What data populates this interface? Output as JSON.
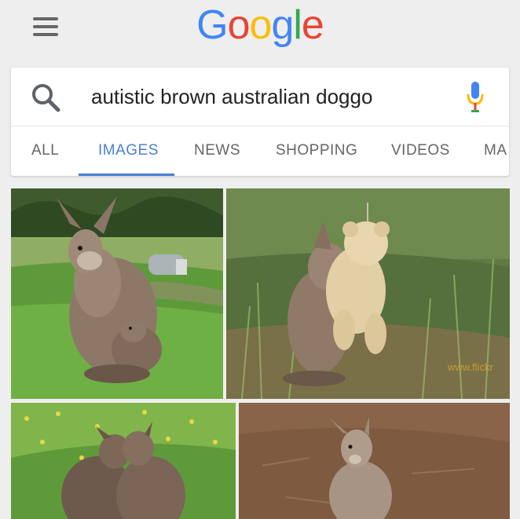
{
  "logo": {
    "letters": [
      "G",
      "o",
      "o",
      "g",
      "l",
      "e"
    ],
    "colors": [
      "#4285F4",
      "#EA4335",
      "#FBBC05",
      "#4285F4",
      "#34A853",
      "#EA4335"
    ]
  },
  "search": {
    "query": "autistic brown australian doggo"
  },
  "tabs": [
    {
      "label": "ALL"
    },
    {
      "label": "IMAGES",
      "active": true
    },
    {
      "label": "NEWS"
    },
    {
      "label": "SHOPPING"
    },
    {
      "label": "VIDEOS"
    },
    {
      "label": "MA"
    }
  ],
  "colors": {
    "accent": "#4a7fd6",
    "mic_blue": "#4285F4",
    "mic_red": "#EA4335"
  },
  "icons": [
    "menu-icon",
    "search-icon",
    "microphone-icon"
  ],
  "images": [
    {
      "subject": "kangaroo-with-joey-photo"
    },
    {
      "subject": "joey-hugging-teddy-bear-photo",
      "watermark": "www.flickr"
    },
    {
      "subject": "two-wallabies-hugging-photo"
    },
    {
      "subject": "wallaby-sitting-photo"
    }
  ]
}
